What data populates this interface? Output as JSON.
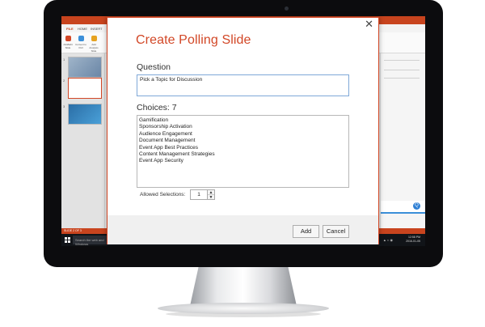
{
  "ppt": {
    "tabs": [
      "FILE",
      "HOME",
      "INSERT"
    ],
    "ribbon_buttons": [
      "Add/Edit Slide",
      "Convert to Poll",
      "Add Analysis Slide"
    ],
    "slide_numbers": [
      "1",
      "2",
      "3"
    ],
    "status": "SLIDE 2 OF 3",
    "taskbar_search": "Search the web and Windows",
    "clock_time": "12:58 PM",
    "clock_date": "2016-01-05",
    "accent_color": "#c8441e"
  },
  "dialog": {
    "title": "Create Polling Slide",
    "close_glyph": "✕",
    "question_label": "Question",
    "question_value": "Pick a Topic for Discussion",
    "choices_label": "Choices: 7",
    "choices": [
      "Gamification",
      "Sponsorship Activation",
      "Audience Engagement",
      "Document Management",
      "Event App Best Practices",
      "Content Management Strategies",
      "Event App Security"
    ],
    "allowed_label": "Allowed Selections:",
    "allowed_value": "1",
    "add_label": "Add",
    "cancel_label": "Cancel",
    "title_color": "#d24726"
  }
}
